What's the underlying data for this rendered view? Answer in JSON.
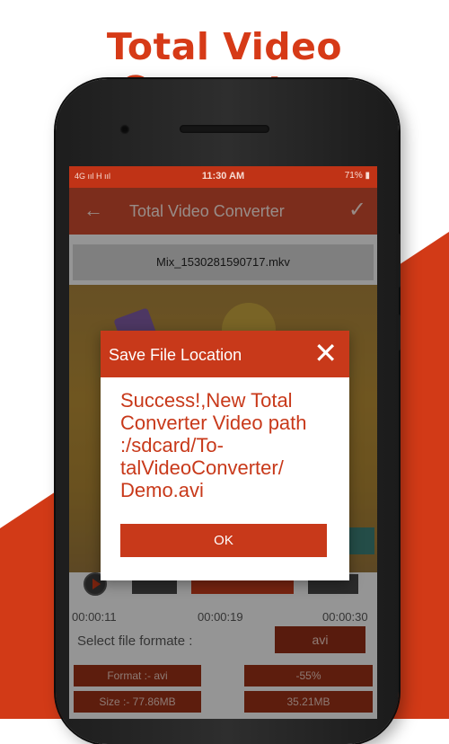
{
  "headline": "Total Video Converter",
  "colors": {
    "accent": "#c8391a",
    "headline": "#d63a17",
    "statusbar": "#c03316"
  },
  "status_bar": {
    "left": "4G ııl H ııl",
    "time": "11:30 AM",
    "right": "71% ▮"
  },
  "app_bar": {
    "back_icon": "arrow-left-icon",
    "title": "Total Video Converter",
    "check_icon": "check-icon"
  },
  "file_name": "Mix_1530281590717.mkv",
  "timeline": {
    "start": "00:00:11",
    "current": "00:00:19",
    "end": "00:00:30"
  },
  "format": {
    "label": "Select file formate :",
    "value": "avi"
  },
  "info": {
    "format": "Format :- avi",
    "percent": "-55%",
    "size": "Size :- 77.86MB",
    "new_size": "35.21MB"
  },
  "dialog": {
    "title": "Save File Location",
    "close_icon": "close-icon",
    "message": "Success!,New Total Converter Video path :/sdcard/To-talVideoConverter/ Demo.avi",
    "ok_label": "OK"
  }
}
